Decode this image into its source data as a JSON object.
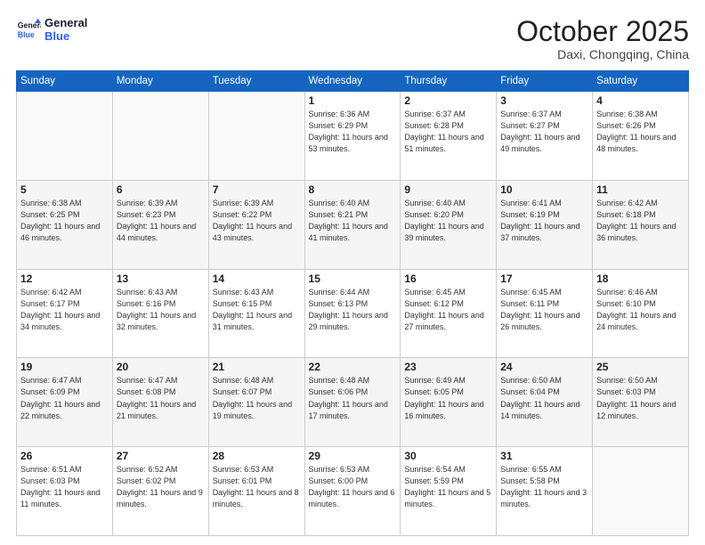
{
  "header": {
    "logo_line1": "General",
    "logo_line2": "Blue",
    "month": "October 2025",
    "location": "Daxi, Chongqing, China"
  },
  "days_of_week": [
    "Sunday",
    "Monday",
    "Tuesday",
    "Wednesday",
    "Thursday",
    "Friday",
    "Saturday"
  ],
  "weeks": [
    [
      {
        "day": "",
        "info": ""
      },
      {
        "day": "",
        "info": ""
      },
      {
        "day": "",
        "info": ""
      },
      {
        "day": "1",
        "info": "Sunrise: 6:36 AM\nSunset: 6:29 PM\nDaylight: 11 hours and 53 minutes."
      },
      {
        "day": "2",
        "info": "Sunrise: 6:37 AM\nSunset: 6:28 PM\nDaylight: 11 hours and 51 minutes."
      },
      {
        "day": "3",
        "info": "Sunrise: 6:37 AM\nSunset: 6:27 PM\nDaylight: 11 hours and 49 minutes."
      },
      {
        "day": "4",
        "info": "Sunrise: 6:38 AM\nSunset: 6:26 PM\nDaylight: 11 hours and 48 minutes."
      }
    ],
    [
      {
        "day": "5",
        "info": "Sunrise: 6:38 AM\nSunset: 6:25 PM\nDaylight: 11 hours and 46 minutes."
      },
      {
        "day": "6",
        "info": "Sunrise: 6:39 AM\nSunset: 6:23 PM\nDaylight: 11 hours and 44 minutes."
      },
      {
        "day": "7",
        "info": "Sunrise: 6:39 AM\nSunset: 6:22 PM\nDaylight: 11 hours and 43 minutes."
      },
      {
        "day": "8",
        "info": "Sunrise: 6:40 AM\nSunset: 6:21 PM\nDaylight: 11 hours and 41 minutes."
      },
      {
        "day": "9",
        "info": "Sunrise: 6:40 AM\nSunset: 6:20 PM\nDaylight: 11 hours and 39 minutes."
      },
      {
        "day": "10",
        "info": "Sunrise: 6:41 AM\nSunset: 6:19 PM\nDaylight: 11 hours and 37 minutes."
      },
      {
        "day": "11",
        "info": "Sunrise: 6:42 AM\nSunset: 6:18 PM\nDaylight: 11 hours and 36 minutes."
      }
    ],
    [
      {
        "day": "12",
        "info": "Sunrise: 6:42 AM\nSunset: 6:17 PM\nDaylight: 11 hours and 34 minutes."
      },
      {
        "day": "13",
        "info": "Sunrise: 6:43 AM\nSunset: 6:16 PM\nDaylight: 11 hours and 32 minutes."
      },
      {
        "day": "14",
        "info": "Sunrise: 6:43 AM\nSunset: 6:15 PM\nDaylight: 11 hours and 31 minutes."
      },
      {
        "day": "15",
        "info": "Sunrise: 6:44 AM\nSunset: 6:13 PM\nDaylight: 11 hours and 29 minutes."
      },
      {
        "day": "16",
        "info": "Sunrise: 6:45 AM\nSunset: 6:12 PM\nDaylight: 11 hours and 27 minutes."
      },
      {
        "day": "17",
        "info": "Sunrise: 6:45 AM\nSunset: 6:11 PM\nDaylight: 11 hours and 26 minutes."
      },
      {
        "day": "18",
        "info": "Sunrise: 6:46 AM\nSunset: 6:10 PM\nDaylight: 11 hours and 24 minutes."
      }
    ],
    [
      {
        "day": "19",
        "info": "Sunrise: 6:47 AM\nSunset: 6:09 PM\nDaylight: 11 hours and 22 minutes."
      },
      {
        "day": "20",
        "info": "Sunrise: 6:47 AM\nSunset: 6:08 PM\nDaylight: 11 hours and 21 minutes."
      },
      {
        "day": "21",
        "info": "Sunrise: 6:48 AM\nSunset: 6:07 PM\nDaylight: 11 hours and 19 minutes."
      },
      {
        "day": "22",
        "info": "Sunrise: 6:48 AM\nSunset: 6:06 PM\nDaylight: 11 hours and 17 minutes."
      },
      {
        "day": "23",
        "info": "Sunrise: 6:49 AM\nSunset: 6:05 PM\nDaylight: 11 hours and 16 minutes."
      },
      {
        "day": "24",
        "info": "Sunrise: 6:50 AM\nSunset: 6:04 PM\nDaylight: 11 hours and 14 minutes."
      },
      {
        "day": "25",
        "info": "Sunrise: 6:50 AM\nSunset: 6:03 PM\nDaylight: 11 hours and 12 minutes."
      }
    ],
    [
      {
        "day": "26",
        "info": "Sunrise: 6:51 AM\nSunset: 6:03 PM\nDaylight: 11 hours and 11 minutes."
      },
      {
        "day": "27",
        "info": "Sunrise: 6:52 AM\nSunset: 6:02 PM\nDaylight: 11 hours and 9 minutes."
      },
      {
        "day": "28",
        "info": "Sunrise: 6:53 AM\nSunset: 6:01 PM\nDaylight: 11 hours and 8 minutes."
      },
      {
        "day": "29",
        "info": "Sunrise: 6:53 AM\nSunset: 6:00 PM\nDaylight: 11 hours and 6 minutes."
      },
      {
        "day": "30",
        "info": "Sunrise: 6:54 AM\nSunset: 5:59 PM\nDaylight: 11 hours and 5 minutes."
      },
      {
        "day": "31",
        "info": "Sunrise: 6:55 AM\nSunset: 5:58 PM\nDaylight: 11 hours and 3 minutes."
      },
      {
        "day": "",
        "info": ""
      }
    ]
  ]
}
